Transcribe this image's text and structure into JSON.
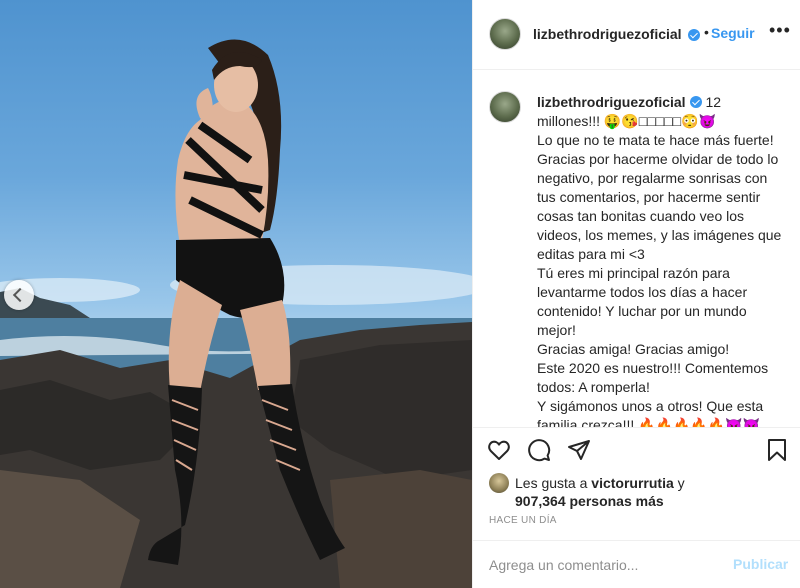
{
  "post": {
    "username": "lizbethrodriguezoficial",
    "follow_label": "Seguir",
    "dot": "•",
    "more": "•••",
    "caption": {
      "count": "12",
      "text": "millones!!! 🤑😘□□□□□😳😈\nLo que no te mata te hace más fuerte!\nGracias por hacerme olvidar de todo lo negativo, por regalarme sonrisas con tus comentarios, por hacerme sentir cosas tan bonitas cuando veo los videos, los memes, y las imágenes que editas para mi <3\nTú eres mi principal razón para levantarme todos los días a hacer contenido! Y luchar por un mundo mejor!\nGracias amiga! Gracias amigo!\nEste 2020 es nuestro!!! Comentemos todos: A romperla!\nY sigámonos unos a otros! Que esta familia crezca!!! 🔥🔥🔥🔥🔥😈😈"
    },
    "likes": {
      "prefix": "Les gusta a",
      "user": "victorurrutia",
      "suffix": "y",
      "count_text": "907,364 personas más"
    },
    "timestamp": "HACE UN DÍA",
    "comment": {
      "placeholder": "Agrega un comentario...",
      "publish_label": "Publicar"
    },
    "icons": [
      "heart-icon",
      "comment-icon",
      "share-icon",
      "bookmark-icon",
      "verified-icon",
      "more-options-icon"
    ],
    "colors": {
      "accent": "#3897f0",
      "publish_disabled": "#b2dffc",
      "text": "#262626",
      "muted": "#8e8e8e"
    }
  }
}
